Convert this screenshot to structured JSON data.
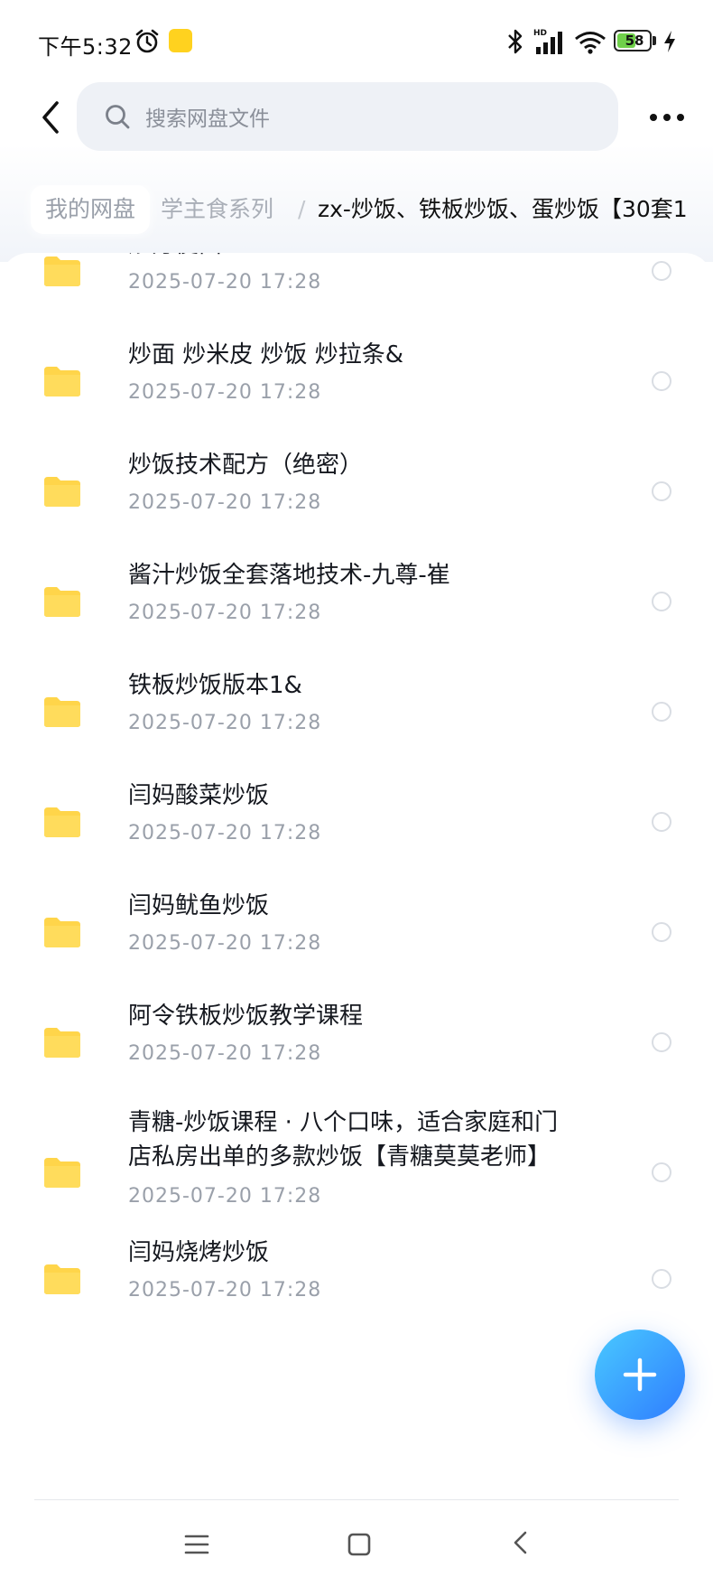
{
  "status_bar": {
    "time": "下午5:32",
    "battery_level": "58",
    "battery_fraction": 0.58,
    "network_badge": "HD"
  },
  "header": {
    "search_placeholder": "搜索网盘文件"
  },
  "breadcrumb": {
    "home": "我的网盘",
    "middle": "学主食系列",
    "separator": "/",
    "current": "zx-炒饭、铁板炒饭、蛋炒饭【30套1"
  },
  "files": [
    {
      "name": "炒方便面&",
      "date": "2025-07-20  17:28"
    },
    {
      "name": "炒面 炒米皮 炒饭 炒拉条&",
      "date": "2025-07-20  17:28"
    },
    {
      "name": "炒饭技术配方（绝密）",
      "date": "2025-07-20  17:28"
    },
    {
      "name": "酱汁炒饭全套落地技术-九尊-崔",
      "date": "2025-07-20  17:28"
    },
    {
      "name": "铁板炒饭版本1&",
      "date": "2025-07-20  17:28"
    },
    {
      "name": "闫妈酸菜炒饭",
      "date": "2025-07-20  17:28"
    },
    {
      "name": "闫妈鱿鱼炒饭",
      "date": "2025-07-20  17:28"
    },
    {
      "name": "阿令铁板炒饭教学课程",
      "date": "2025-07-20  17:28"
    },
    {
      "name": "青糖-炒饭课程 · 八个口味，适合家庭和门\n店私房出单的多款炒饭【青糖莫莫老师】",
      "date": "2025-07-20  17:28"
    },
    {
      "name": "闫妈烧烤炒饭",
      "date": "2025-07-20  17:28"
    }
  ],
  "colors": {
    "folder": "#ffd54a",
    "fab_start": "#49c9ff",
    "fab_end": "#2f7dff",
    "secondary_text": "#9aa0aa"
  },
  "icons": {
    "back": "chevron-left-icon",
    "search": "search-icon",
    "more": "more-horizontal-icon",
    "folder": "folder-icon",
    "fab": "plus-icon",
    "nav_menu": "menu-icon",
    "nav_home": "square-home-icon",
    "nav_back": "chevron-left-icon"
  }
}
